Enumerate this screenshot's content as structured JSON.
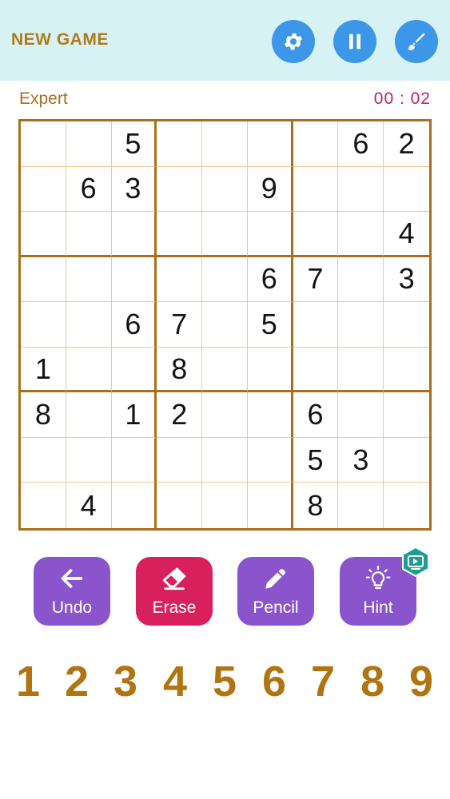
{
  "header": {
    "new_game_label": "NEW GAME",
    "settings_icon": "gear-icon",
    "pause_icon": "pause-icon",
    "theme_icon": "paint-brush-icon",
    "button_color": "#3d97e8",
    "background_color": "#d6f2f4"
  },
  "status": {
    "difficulty": "Expert",
    "timer": "00 : 02"
  },
  "board": {
    "rows": [
      [
        "",
        "",
        "5",
        "",
        "",
        "",
        "",
        "6",
        "2"
      ],
      [
        "",
        "6",
        "3",
        "",
        "",
        "9",
        "",
        "",
        ""
      ],
      [
        "",
        "",
        "",
        "",
        "",
        "",
        "",
        "",
        "4"
      ],
      [
        "",
        "",
        "",
        "",
        "",
        "6",
        "7",
        "",
        "3"
      ],
      [
        "",
        "",
        "6",
        "7",
        "",
        "5",
        "",
        "",
        ""
      ],
      [
        "1",
        "",
        "",
        "8",
        "",
        "",
        "",
        "",
        ""
      ],
      [
        "8",
        "",
        "1",
        "2",
        "",
        "",
        "6",
        "",
        ""
      ],
      [
        "",
        "",
        "",
        "",
        "",
        "",
        "5",
        "3",
        ""
      ],
      [
        "",
        "4",
        "",
        "",
        "",
        "",
        "8",
        "",
        ""
      ]
    ]
  },
  "tools": [
    {
      "label": "Undo",
      "icon": "arrow-left-icon",
      "color": "#8a55cc"
    },
    {
      "label": "Erase",
      "icon": "eraser-icon",
      "color": "#d8205c"
    },
    {
      "label": "Pencil",
      "icon": "pencil-icon",
      "color": "#8a55cc"
    },
    {
      "label": "Hint",
      "icon": "lightbulb-icon",
      "color": "#8a55cc"
    }
  ],
  "hint_badge_icon": "video-play-icon",
  "numpad": [
    "1",
    "2",
    "3",
    "4",
    "5",
    "6",
    "7",
    "8",
    "9"
  ]
}
